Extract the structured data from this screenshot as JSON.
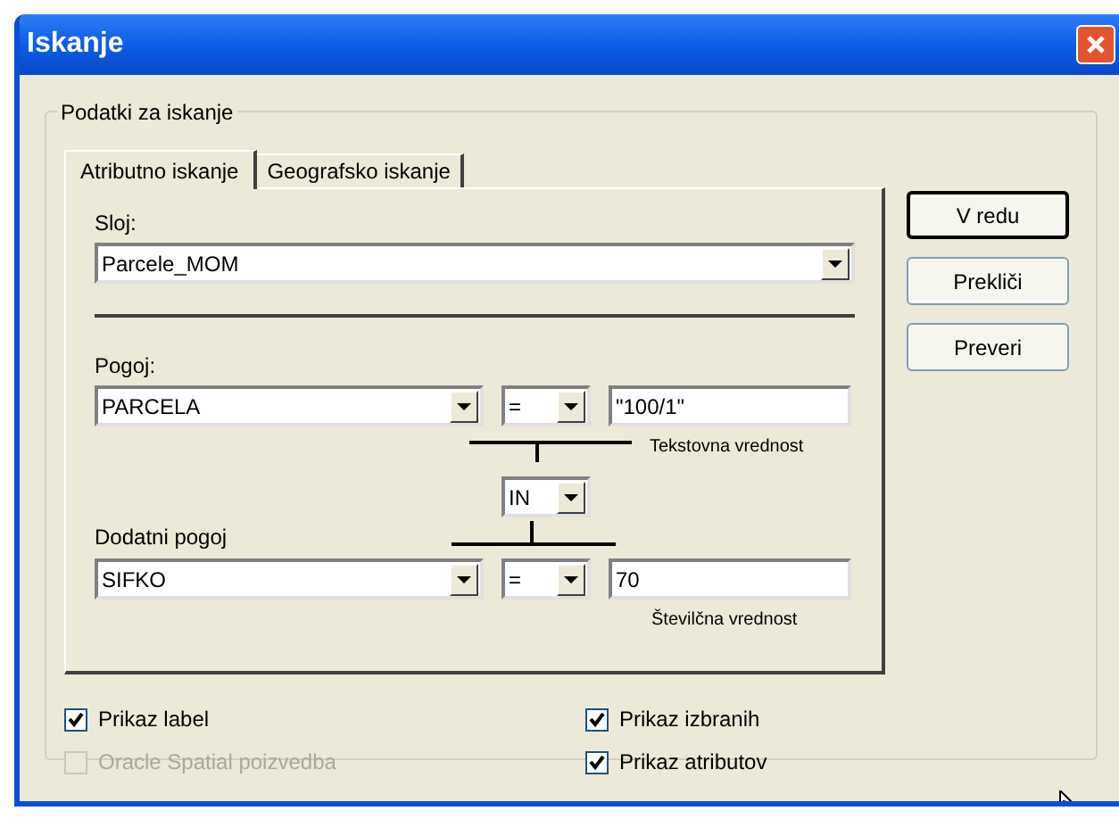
{
  "window": {
    "title": "Iskanje"
  },
  "group": {
    "title": "Podatki za iskanje"
  },
  "tabs": [
    {
      "label": "Atributno iskanje",
      "selected": true
    },
    {
      "label": "Geografsko iskanje",
      "selected": false
    }
  ],
  "layer": {
    "label": "Sloj:",
    "value": "Parcele_MOM"
  },
  "condition": {
    "label": "Pogoj:",
    "field": "PARCELA",
    "operator": "=",
    "value": "\"100/1\"",
    "hint": "Tekstovna vrednost"
  },
  "joiner": {
    "value": "IN"
  },
  "extra_condition": {
    "label": "Dodatni pogoj",
    "field": "SIFKO",
    "operator": "=",
    "value": "70",
    "hint": "Številčna vrednost"
  },
  "buttons": [
    "V redu",
    "Prekliči",
    "Preveri"
  ],
  "checkboxes": [
    {
      "label": "Prikaz label",
      "checked": true,
      "disabled": false
    },
    {
      "label": "Oracle Spatial poizvedba",
      "checked": false,
      "disabled": true
    },
    {
      "label": "Prikaz izbranih",
      "checked": true,
      "disabled": false
    },
    {
      "label": "Prikaz atributov",
      "checked": true,
      "disabled": false
    }
  ]
}
